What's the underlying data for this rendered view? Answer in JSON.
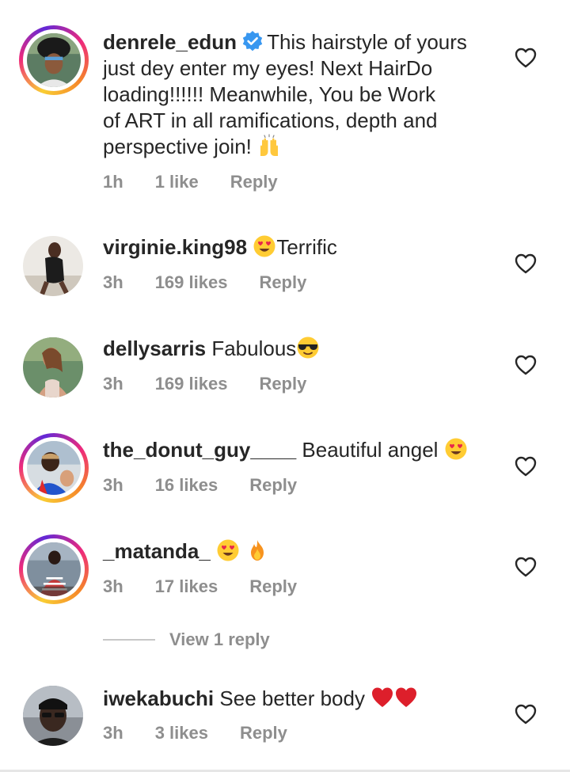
{
  "comments": [
    {
      "username": "denrele_edun",
      "verified": true,
      "lines": [
        "This hairstyle of yours",
        "just dey enter my eyes! Next HairDo",
        "loading!!!!!! Meanwhile, You be Work",
        "of ART in all ramifications, depth and",
        "perspective join!"
      ],
      "emoji_after": "raising-hands",
      "time": "1h",
      "likes": "1 like",
      "reply": "Reply",
      "avatar_ring": true
    },
    {
      "username": "virginie.king98",
      "text_before": "",
      "emoji_inline": "heart-eyes",
      "text": "Terrific",
      "time": "3h",
      "likes": "169 likes",
      "reply": "Reply",
      "avatar_ring": false
    },
    {
      "username": "dellysarris",
      "text": "Fabulous",
      "emoji_after": "sunglasses",
      "time": "3h",
      "likes": "169 likes",
      "reply": "Reply",
      "avatar_ring": false
    },
    {
      "username": "the_donut_guy____",
      "text": "Beautiful angel",
      "emoji_after": "heart-eyes",
      "time": "3h",
      "likes": "16 likes",
      "reply": "Reply",
      "avatar_ring": true
    },
    {
      "username": "_matanda_",
      "text": "",
      "emoji_after": "heart-eyes fire",
      "time": "3h",
      "likes": "17 likes",
      "reply": "Reply",
      "avatar_ring": true
    },
    {
      "username": "iwekabuchi",
      "text": "See better body",
      "emoji_after": "red-heart red-heart",
      "time": "3h",
      "likes": "3 likes",
      "reply": "Reply",
      "avatar_ring": false
    }
  ],
  "view_replies": "View 1 reply",
  "colors": {
    "text": "#262626",
    "meta": "#8e8e8e",
    "verified": "#3897f0",
    "divider": "#c7c7c7"
  }
}
